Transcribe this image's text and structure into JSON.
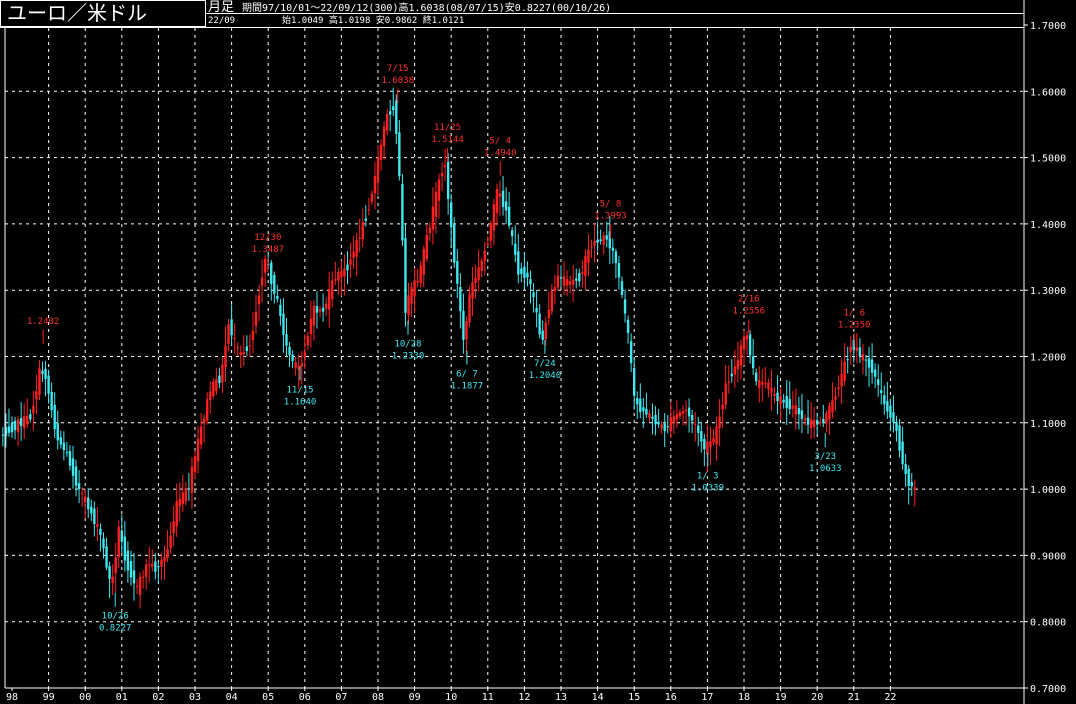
{
  "header": {
    "pair_title": "ユーロ／米ドル",
    "period_label": "月足",
    "summary_line": "期間97/10/01〜22/09/12(300)高1.6038(08/07/15)安0.8227(00/10/26)",
    "latest_date": "22/09",
    "latest_ohlc": "始1.0049 高1.0198 安0.9862 終1.0121"
  },
  "colors": {
    "up": "#ff2020",
    "down": "#40e8f0",
    "grid": "#ffffff",
    "background": "#000000",
    "high_label": "#ff3030",
    "low_label": "#40e8f0"
  },
  "chart_data": {
    "type": "candlestick",
    "ylim": [
      0.7,
      1.7
    ],
    "y_ticks": [
      "1.7000",
      "1.6000",
      "1.5000",
      "1.4000",
      "1.3000",
      "1.2000",
      "1.1000",
      "1.0000",
      "0.9000",
      "0.8000",
      "0.7000"
    ],
    "x_ticks": [
      "98",
      "99",
      "00",
      "01",
      "02",
      "03",
      "04",
      "05",
      "06",
      "07",
      "08",
      "09",
      "10",
      "11",
      "12",
      "13",
      "14",
      "15",
      "16",
      "17",
      "18",
      "19",
      "20",
      "21",
      "22"
    ],
    "grid": true,
    "annotations": [
      {
        "kind": "high",
        "date": "",
        "price": "1.2402",
        "year": 1998.85
      },
      {
        "kind": "low",
        "date": "10/26",
        "price": "0.8227",
        "year": 2000.82
      },
      {
        "kind": "high",
        "date": "12/30",
        "price": "1.3487",
        "year": 2004.99
      },
      {
        "kind": "low",
        "date": "11/15",
        "price": "1.1640",
        "year": 2005.87
      },
      {
        "kind": "high",
        "date": "7/15",
        "price": "1.6038",
        "year": 2008.54
      },
      {
        "kind": "low",
        "date": "10/28",
        "price": "1.2330",
        "year": 2008.82
      },
      {
        "kind": "high",
        "date": "11/25",
        "price": "1.5144",
        "year": 2009.9
      },
      {
        "kind": "low",
        "date": "6/ 7",
        "price": "1.1877",
        "year": 2010.43
      },
      {
        "kind": "high",
        "date": "5/ 4",
        "price": "1.4940",
        "year": 2011.34
      },
      {
        "kind": "low",
        "date": "7/24",
        "price": "1.2040",
        "year": 2012.56
      },
      {
        "kind": "high",
        "date": "5/ 8",
        "price": "1.3993",
        "year": 2014.35
      },
      {
        "kind": "low",
        "date": "1/ 3",
        "price": "1.0339",
        "year": 2017.01
      },
      {
        "kind": "high",
        "date": "2/16",
        "price": "1.2556",
        "year": 2018.13
      },
      {
        "kind": "low",
        "date": "3/23",
        "price": "1.0633",
        "year": 2020.22
      },
      {
        "kind": "high",
        "date": "1/ 6",
        "price": "1.2350",
        "year": 2021.01
      }
    ],
    "path": [
      [
        1997.75,
        1.08
      ],
      [
        1998.0,
        1.09
      ],
      [
        1998.3,
        1.1
      ],
      [
        1998.6,
        1.11
      ],
      [
        1998.85,
        1.18
      ],
      [
        1999.0,
        1.17
      ],
      [
        1999.3,
        1.08
      ],
      [
        1999.6,
        1.05
      ],
      [
        1999.9,
        1.0
      ],
      [
        2000.2,
        0.97
      ],
      [
        2000.5,
        0.93
      ],
      [
        2000.8,
        0.85
      ],
      [
        2001.0,
        0.94
      ],
      [
        2001.2,
        0.89
      ],
      [
        2001.5,
        0.85
      ],
      [
        2001.8,
        0.89
      ],
      [
        2002.0,
        0.88
      ],
      [
        2002.3,
        0.9
      ],
      [
        2002.6,
        0.98
      ],
      [
        2002.9,
        1.0
      ],
      [
        2003.2,
        1.08
      ],
      [
        2003.5,
        1.15
      ],
      [
        2003.8,
        1.17
      ],
      [
        2004.0,
        1.25
      ],
      [
        2004.3,
        1.2
      ],
      [
        2004.6,
        1.22
      ],
      [
        2004.99,
        1.35
      ],
      [
        2005.3,
        1.29
      ],
      [
        2005.6,
        1.21
      ],
      [
        2005.87,
        1.18
      ],
      [
        2006.0,
        1.19
      ],
      [
        2006.3,
        1.27
      ],
      [
        2006.6,
        1.27
      ],
      [
        2006.9,
        1.32
      ],
      [
        2007.2,
        1.33
      ],
      [
        2007.5,
        1.37
      ],
      [
        2007.8,
        1.42
      ],
      [
        2008.0,
        1.47
      ],
      [
        2008.3,
        1.56
      ],
      [
        2008.54,
        1.58
      ],
      [
        2008.7,
        1.44
      ],
      [
        2008.82,
        1.27
      ],
      [
        2009.0,
        1.3
      ],
      [
        2009.2,
        1.32
      ],
      [
        2009.5,
        1.4
      ],
      [
        2009.9,
        1.5
      ],
      [
        2010.1,
        1.38
      ],
      [
        2010.43,
        1.22
      ],
      [
        2010.6,
        1.3
      ],
      [
        2010.9,
        1.34
      ],
      [
        2011.1,
        1.38
      ],
      [
        2011.34,
        1.45
      ],
      [
        2011.6,
        1.42
      ],
      [
        2011.9,
        1.33
      ],
      [
        2012.2,
        1.32
      ],
      [
        2012.56,
        1.22
      ],
      [
        2012.8,
        1.29
      ],
      [
        2013.0,
        1.32
      ],
      [
        2013.3,
        1.31
      ],
      [
        2013.6,
        1.32
      ],
      [
        2013.9,
        1.37
      ],
      [
        2014.35,
        1.38
      ],
      [
        2014.6,
        1.34
      ],
      [
        2014.9,
        1.24
      ],
      [
        2015.1,
        1.13
      ],
      [
        2015.5,
        1.11
      ],
      [
        2015.9,
        1.09
      ],
      [
        2016.2,
        1.11
      ],
      [
        2016.5,
        1.12
      ],
      [
        2016.8,
        1.09
      ],
      [
        2017.01,
        1.06
      ],
      [
        2017.3,
        1.08
      ],
      [
        2017.6,
        1.16
      ],
      [
        2017.9,
        1.19
      ],
      [
        2018.13,
        1.24
      ],
      [
        2018.4,
        1.16
      ],
      [
        2018.7,
        1.16
      ],
      [
        2018.9,
        1.14
      ],
      [
        2019.2,
        1.13
      ],
      [
        2019.5,
        1.12
      ],
      [
        2019.8,
        1.1
      ],
      [
        2020.22,
        1.1
      ],
      [
        2020.5,
        1.13
      ],
      [
        2020.8,
        1.18
      ],
      [
        2021.01,
        1.22
      ],
      [
        2021.3,
        1.2
      ],
      [
        2021.6,
        1.18
      ],
      [
        2021.9,
        1.13
      ],
      [
        2022.2,
        1.1
      ],
      [
        2022.5,
        1.02
      ],
      [
        2022.7,
        1.0
      ]
    ]
  }
}
